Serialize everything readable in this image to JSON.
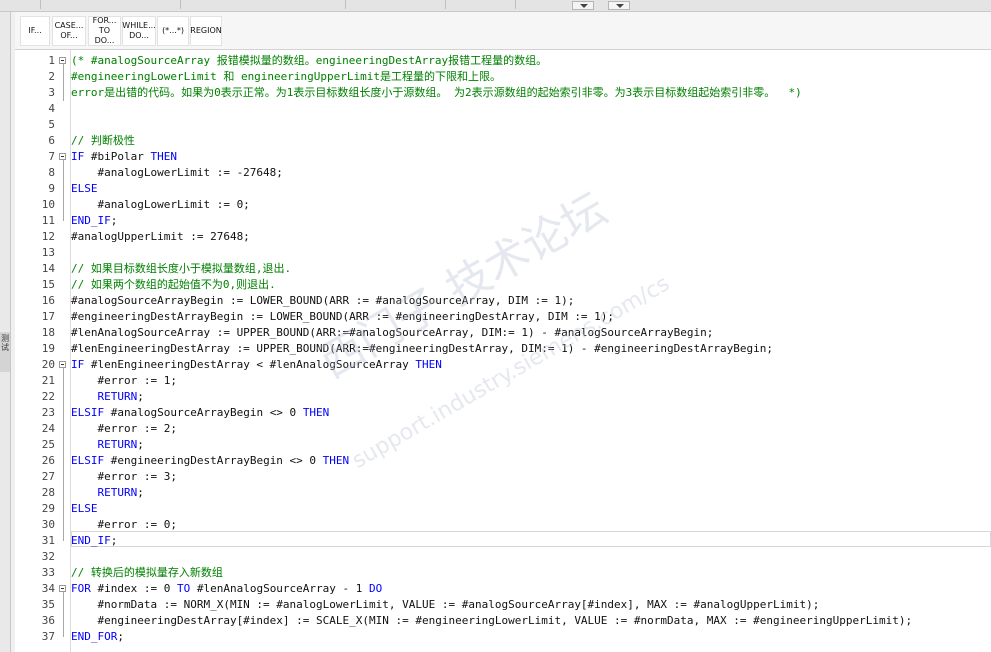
{
  "toolbar": {
    "buttons": [
      {
        "label": "IF...",
        "name": "insert-if-button"
      },
      {
        "label": "CASE... OF...",
        "name": "insert-case-button"
      },
      {
        "label": "FOR... TO DO...",
        "name": "insert-for-button"
      },
      {
        "label": "WHILE... DO...",
        "name": "insert-while-button"
      },
      {
        "label": "(*...*)",
        "name": "insert-comment-button"
      },
      {
        "label": "REGION",
        "name": "insert-region-button"
      }
    ]
  },
  "left_panel": {
    "label": "测试"
  },
  "watermark": {
    "line1": "西门子 技术论坛",
    "line2": "support.industry.siemens.com/cs"
  },
  "colors": {
    "keyword": "#0000ff",
    "comment": "#008000",
    "text": "#111111",
    "line_number": "#444444"
  },
  "editor": {
    "lines": [
      {
        "n": "1",
        "fold": true,
        "tokens": [
          {
            "t": "(* #analogSourceArray 报错模拟量的数组。engineeringDestArray报错工程量的数组。",
            "c": "comment"
          }
        ]
      },
      {
        "n": "2",
        "tokens": [
          {
            "t": "#engineeringLowerLimit 和 engineeringUpperLimit是工程量的下限和上限。",
            "c": "comment"
          }
        ]
      },
      {
        "n": "3",
        "tokens": [
          {
            "t": "error是出错的代码。如果为0表示正常。为1表示目标数组长度小于源数组。 为2表示源数组的起始索引非零。为3表示目标数组起始索引非零。  *)",
            "c": "comment"
          }
        ]
      },
      {
        "n": "4",
        "tokens": []
      },
      {
        "n": "5",
        "tokens": []
      },
      {
        "n": "6",
        "tokens": [
          {
            "t": "// 判断极性",
            "c": "comment"
          }
        ]
      },
      {
        "n": "7",
        "fold": true,
        "tokens": [
          {
            "t": "IF",
            "c": "keyword"
          },
          {
            "t": " #biPolar ",
            "c": "text"
          },
          {
            "t": "THEN",
            "c": "keyword"
          }
        ]
      },
      {
        "n": "8",
        "tokens": [
          {
            "t": "    #analogLowerLimit := -27648;",
            "c": "text"
          }
        ]
      },
      {
        "n": "9",
        "tokens": [
          {
            "t": "ELSE",
            "c": "keyword"
          }
        ]
      },
      {
        "n": "10",
        "tokens": [
          {
            "t": "    #analogLowerLimit := 0;",
            "c": "text"
          }
        ]
      },
      {
        "n": "11",
        "tokens": [
          {
            "t": "END_IF",
            "c": "keyword"
          },
          {
            "t": ";",
            "c": "text"
          }
        ]
      },
      {
        "n": "12",
        "tokens": [
          {
            "t": "#analogUpperLimit := 27648;",
            "c": "text"
          }
        ]
      },
      {
        "n": "13",
        "tokens": []
      },
      {
        "n": "14",
        "tokens": [
          {
            "t": "// 如果目标数组长度小于模拟量数组,退出.",
            "c": "comment"
          }
        ]
      },
      {
        "n": "15",
        "tokens": [
          {
            "t": "// 如果两个数组的起始值不为0,则退出.",
            "c": "comment"
          }
        ]
      },
      {
        "n": "16",
        "tokens": [
          {
            "t": "#analogSourceArrayBegin := LOWER_BOUND(ARR := #analogSourceArray, DIM := 1);",
            "c": "text"
          }
        ]
      },
      {
        "n": "17",
        "tokens": [
          {
            "t": "#engineeringDestArrayBegin := LOWER_BOUND(ARR := #engineeringDestArray, DIM := 1);",
            "c": "text"
          }
        ]
      },
      {
        "n": "18",
        "tokens": [
          {
            "t": "#lenAnalogSourceArray := UPPER_BOUND(ARR:=#analogSourceArray, DIM:= 1) - #analogSourceArrayBegin;",
            "c": "text"
          }
        ]
      },
      {
        "n": "19",
        "tokens": [
          {
            "t": "#lenEngineeringDestArray := UPPER_BOUND(ARR:=#engineeringDestArray, DIM:= 1) - #engineeringDestArrayBegin;",
            "c": "text"
          }
        ]
      },
      {
        "n": "20",
        "fold": true,
        "tokens": [
          {
            "t": "IF",
            "c": "keyword"
          },
          {
            "t": " #lenEngineeringDestArray < #lenAnalogSourceArray ",
            "c": "text"
          },
          {
            "t": "THEN",
            "c": "keyword"
          }
        ]
      },
      {
        "n": "21",
        "tokens": [
          {
            "t": "    #error := 1;",
            "c": "text"
          }
        ]
      },
      {
        "n": "22",
        "tokens": [
          {
            "t": "    ",
            "c": "text"
          },
          {
            "t": "RETURN",
            "c": "keyword"
          },
          {
            "t": ";",
            "c": "text"
          }
        ]
      },
      {
        "n": "23",
        "tokens": [
          {
            "t": "ELSIF",
            "c": "keyword"
          },
          {
            "t": " #analogSourceArrayBegin <> 0 ",
            "c": "text"
          },
          {
            "t": "THEN",
            "c": "keyword"
          }
        ]
      },
      {
        "n": "24",
        "tokens": [
          {
            "t": "    #error := 2;",
            "c": "text"
          }
        ]
      },
      {
        "n": "25",
        "tokens": [
          {
            "t": "    ",
            "c": "text"
          },
          {
            "t": "RETURN",
            "c": "keyword"
          },
          {
            "t": ";",
            "c": "text"
          }
        ]
      },
      {
        "n": "26",
        "tokens": [
          {
            "t": "ELSIF",
            "c": "keyword"
          },
          {
            "t": " #engineeringDestArrayBegin <> 0 ",
            "c": "text"
          },
          {
            "t": "THEN",
            "c": "keyword"
          }
        ]
      },
      {
        "n": "27",
        "tokens": [
          {
            "t": "    #error := 3;",
            "c": "text"
          }
        ]
      },
      {
        "n": "28",
        "tokens": [
          {
            "t": "    ",
            "c": "text"
          },
          {
            "t": "RETURN",
            "c": "keyword"
          },
          {
            "t": ";",
            "c": "text"
          }
        ]
      },
      {
        "n": "29",
        "tokens": [
          {
            "t": "ELSE",
            "c": "keyword"
          }
        ]
      },
      {
        "n": "30",
        "tokens": [
          {
            "t": "    #error := 0;",
            "c": "text"
          }
        ]
      },
      {
        "n": "31",
        "tokens": [
          {
            "t": "END_IF",
            "c": "keyword"
          },
          {
            "t": ";",
            "c": "text"
          }
        ]
      },
      {
        "n": "32",
        "tokens": []
      },
      {
        "n": "33",
        "tokens": [
          {
            "t": "// 转换后的模拟量存入新数组",
            "c": "comment"
          }
        ]
      },
      {
        "n": "34",
        "fold": true,
        "tokens": [
          {
            "t": "FOR",
            "c": "keyword"
          },
          {
            "t": " #index := 0 ",
            "c": "text"
          },
          {
            "t": "TO",
            "c": "keyword"
          },
          {
            "t": " #lenAnalogSourceArray - 1 ",
            "c": "text"
          },
          {
            "t": "DO",
            "c": "keyword"
          }
        ]
      },
      {
        "n": "35",
        "tokens": [
          {
            "t": "    #normData := NORM_X(MIN := #analogLowerLimit, VALUE := #analogSourceArray[#index], MAX := #analogUpperLimit);",
            "c": "text"
          }
        ]
      },
      {
        "n": "36",
        "tokens": [
          {
            "t": "    #engineeringDestArray[#index] := SCALE_X(MIN := #engineeringLowerLimit, VALUE := #normData, MAX := #engineeringUpperLimit);",
            "c": "text"
          }
        ]
      },
      {
        "n": "37",
        "tokens": [
          {
            "t": "END_FOR",
            "c": "keyword"
          },
          {
            "t": ";",
            "c": "text"
          }
        ]
      }
    ]
  }
}
